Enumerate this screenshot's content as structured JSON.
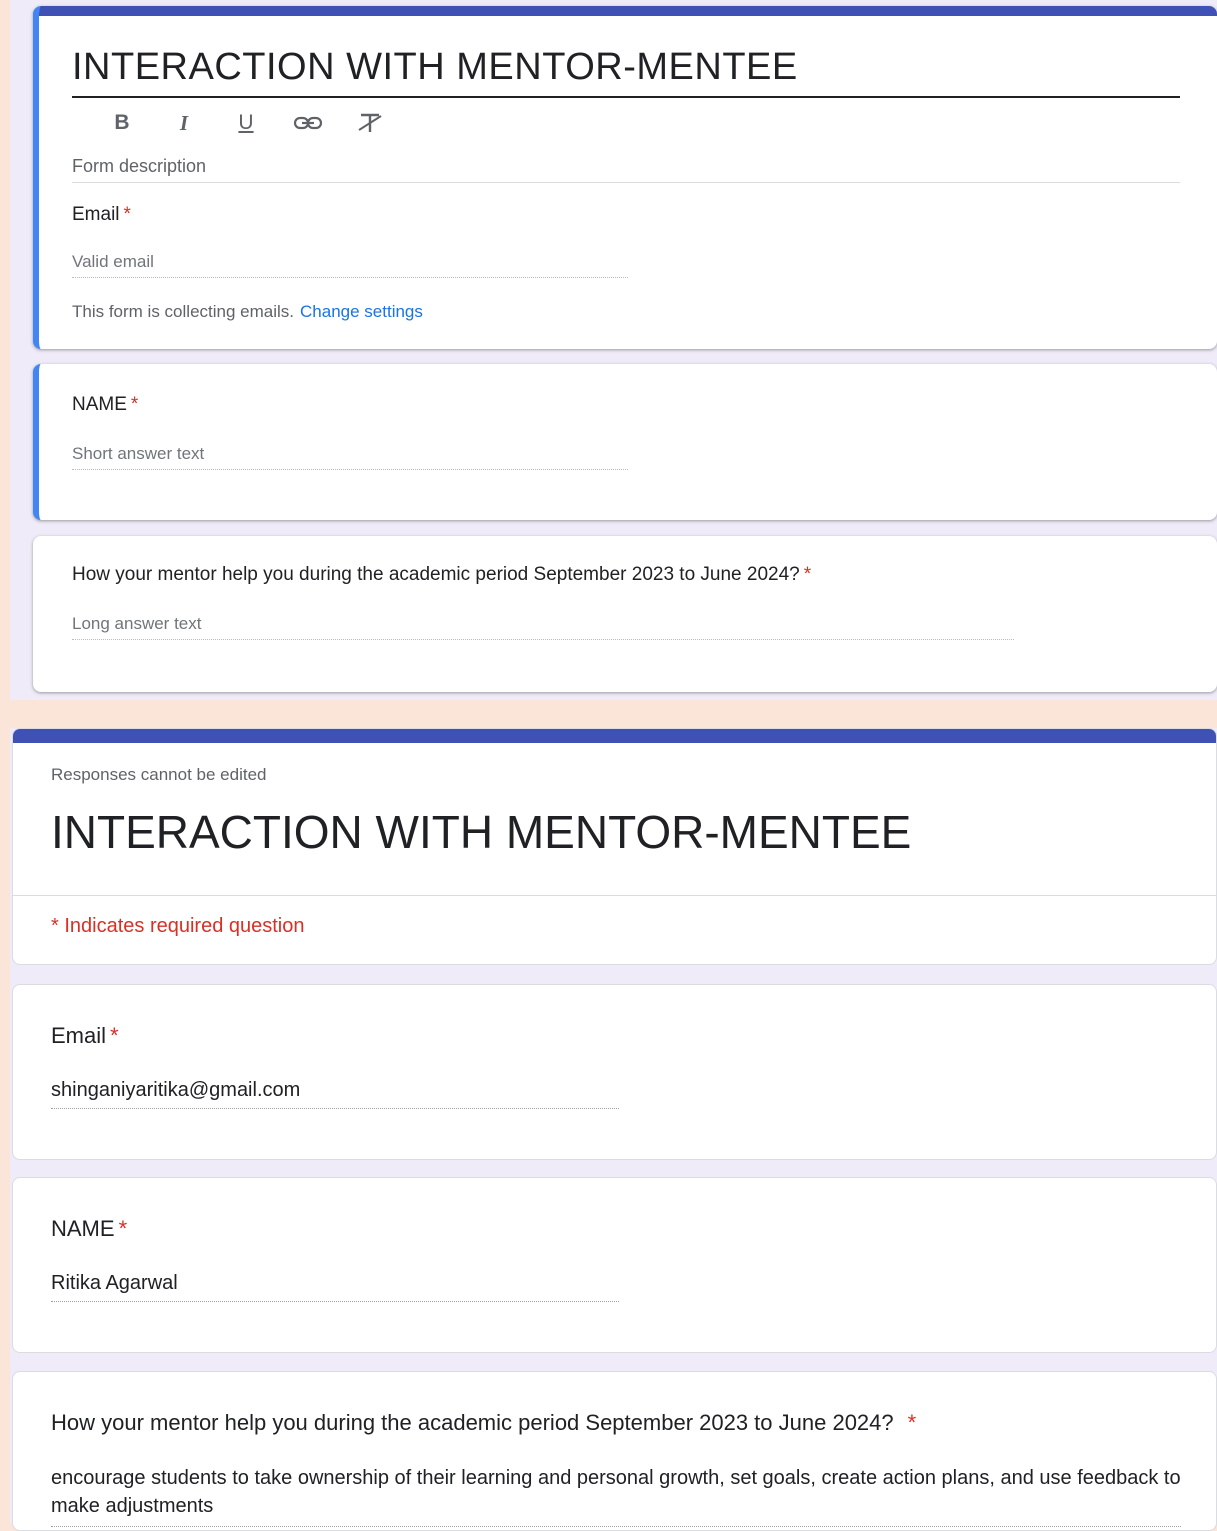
{
  "editor": {
    "title": "INTERACTION WITH MENTOR-MENTEE",
    "format_buttons": {
      "bold": "B",
      "italic": "I",
      "underline": "U",
      "link": "⊂⊃",
      "clear": "T̸"
    },
    "description_placeholder": "Form description",
    "email_label": "Email",
    "email_placeholder": "Valid email",
    "collecting_note": "This form is collecting emails.",
    "change_settings": "Change settings",
    "name_label": "NAME",
    "name_placeholder": "Short answer text",
    "q3_label": "How your mentor help you during the academic period September 2023 to June 2024?",
    "q3_placeholder": "Long answer text",
    "required_mark": "*"
  },
  "response": {
    "note": "Responses cannot be edited",
    "title": "INTERACTION WITH MENTOR-MENTEE",
    "required_note": "* Indicates required question",
    "email_label": "Email",
    "email_value": "shinganiyaritika@gmail.com",
    "name_label": "NAME",
    "name_value": "Ritika Agarwal",
    "q3_label": "How your mentor help you during the academic period September 2023 to June 2024?",
    "q3_value": "encourage students to take ownership of their learning and personal growth, set goals, create action plans, and use feedback to make adjustments",
    "required_mark": "*"
  },
  "colors": {
    "accent": "#3f51b5",
    "focus": "#4285f4",
    "required": "#d93025",
    "link": "#1a73e8",
    "background": "#fbe4d8"
  }
}
